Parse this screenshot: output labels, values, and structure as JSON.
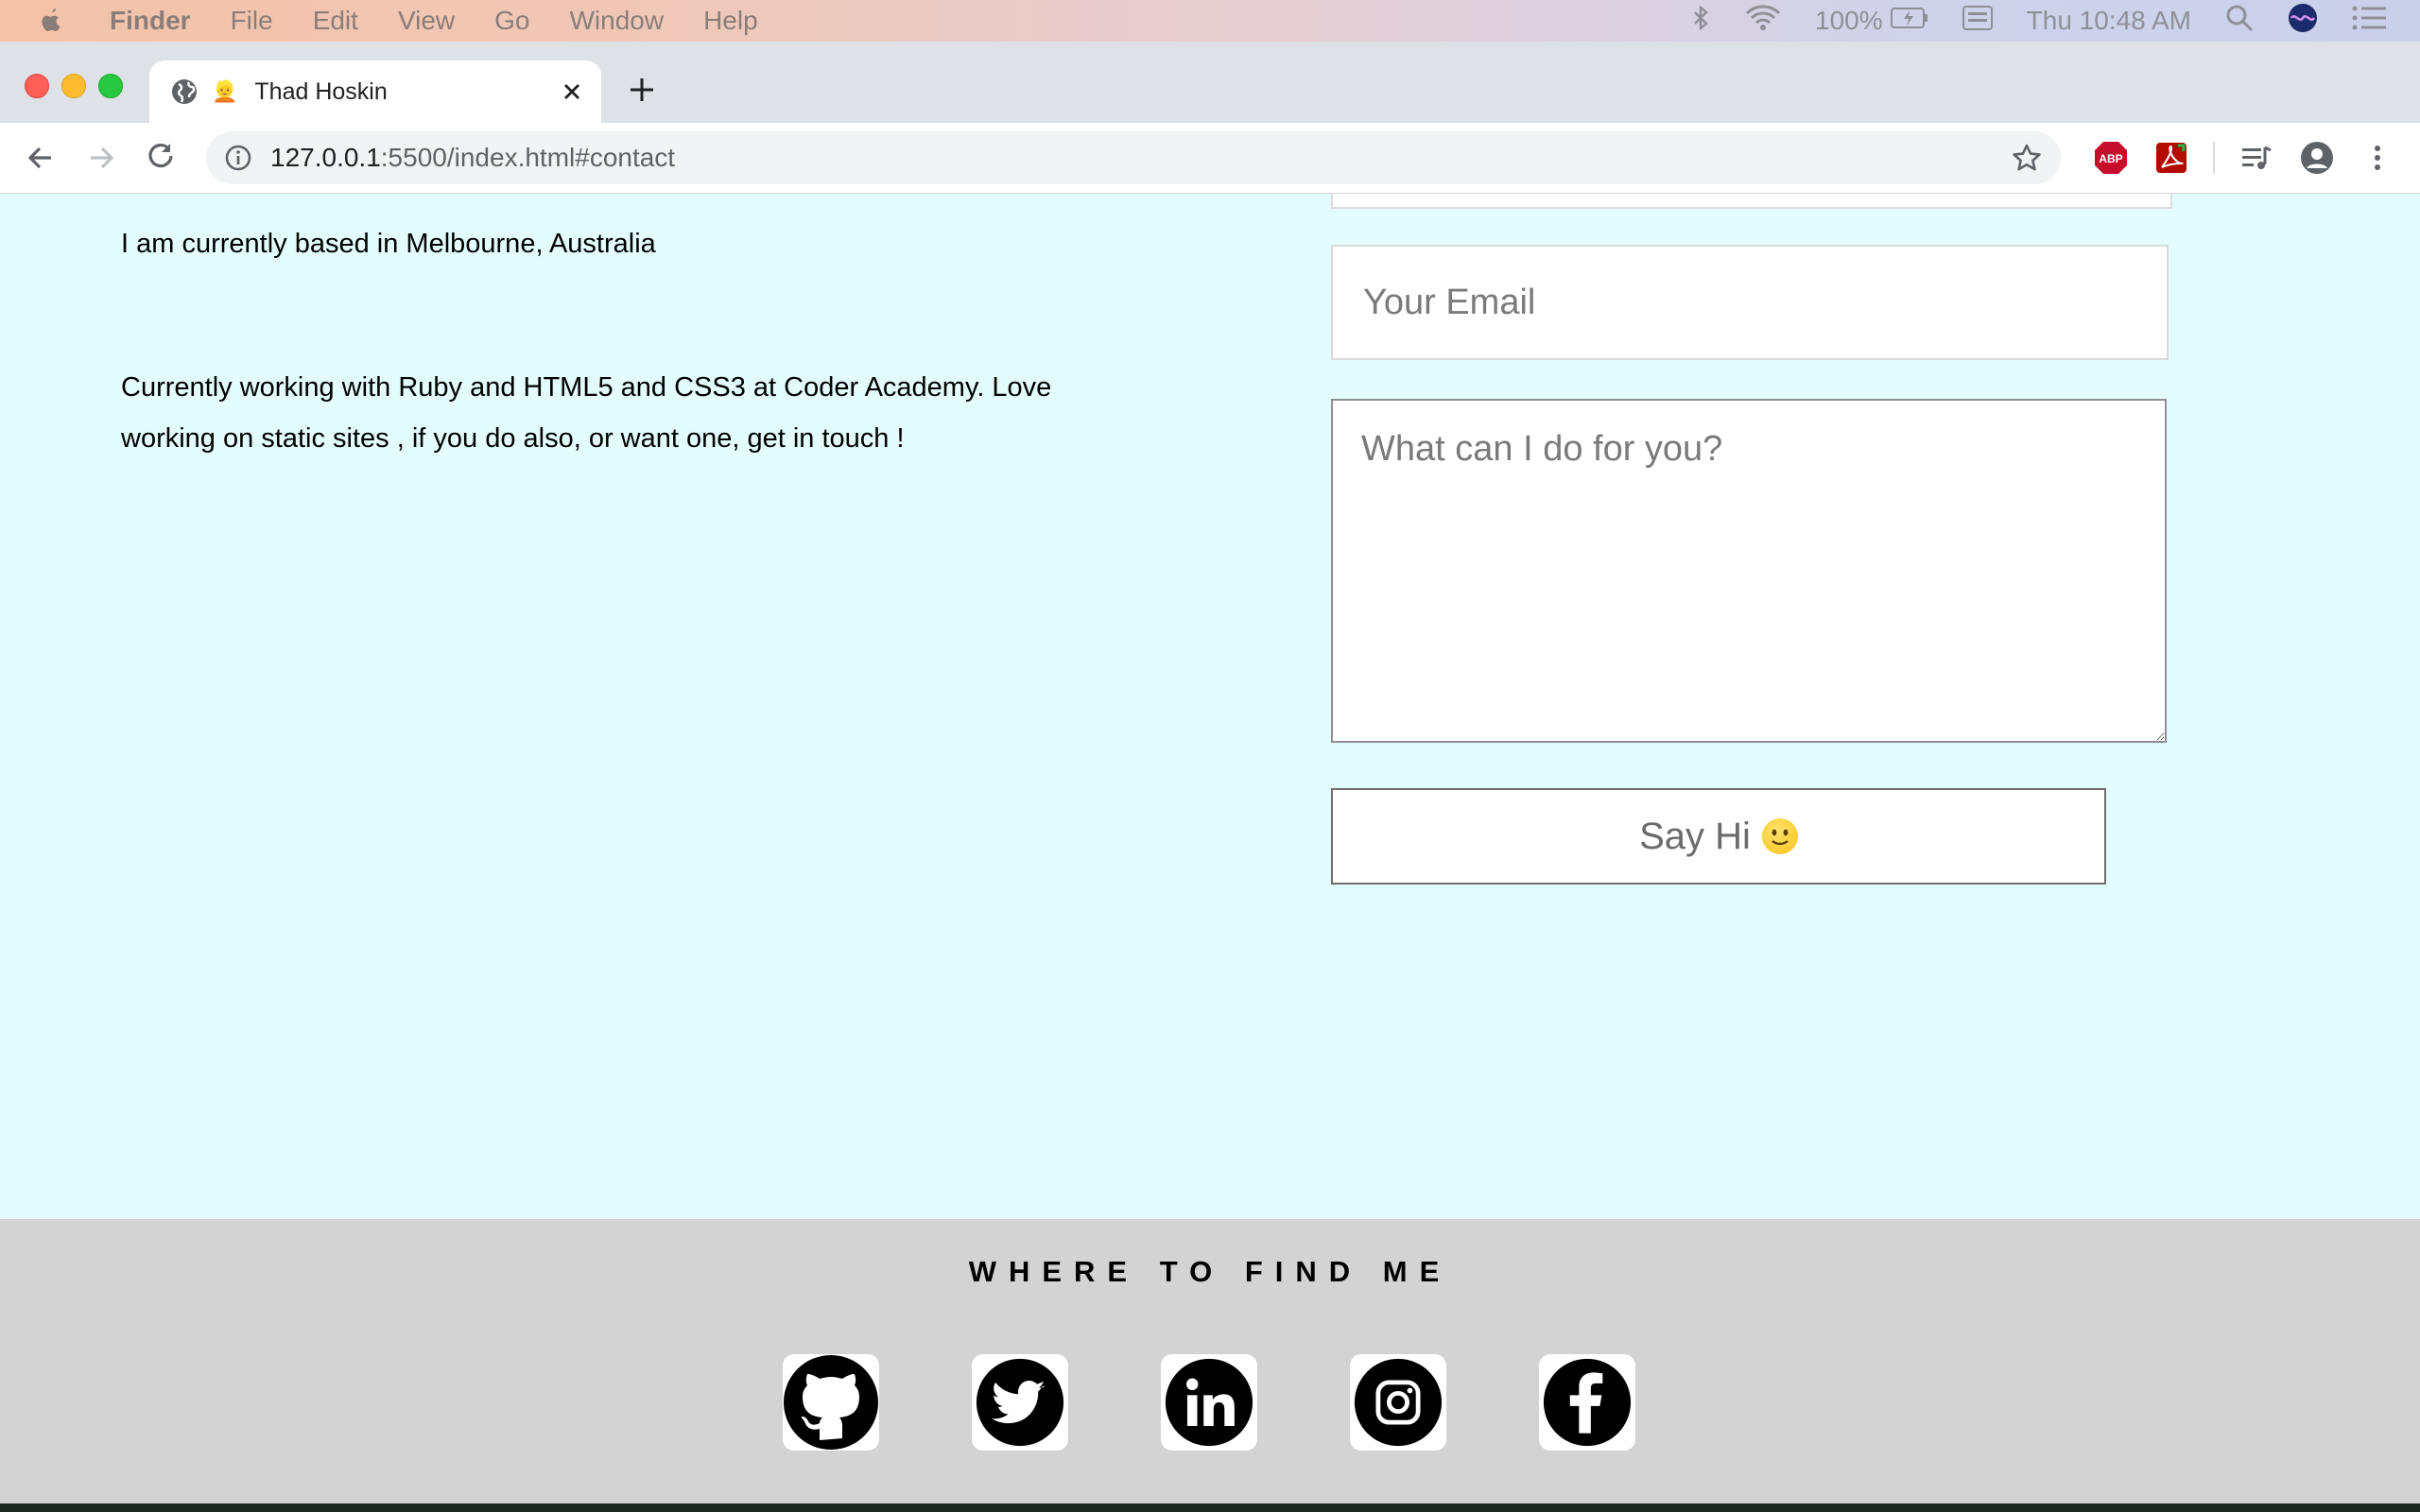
{
  "menubar": {
    "app_name": "Finder",
    "items": [
      "File",
      "Edit",
      "View",
      "Go",
      "Window",
      "Help"
    ],
    "battery": "100%",
    "clock": "Thu 10:48 AM"
  },
  "browser": {
    "tab_title": "Thad Hoskin",
    "tab_favicon": "👱",
    "url_host": "127.0.0.1",
    "url_rest": ":5500/index.html#contact",
    "extensions": [
      "ABP",
      "pdf-extension-icon",
      "media-control-icon",
      "profile-icon",
      "menu-icon"
    ]
  },
  "about": {
    "location": "I am currently based in Melbourne, Australia",
    "bio": "Currently working with Ruby and HTML5 and CSS3 at Coder Academy. Love working on static sites , if you do also, or want one, get in touch !"
  },
  "contact_form": {
    "email_placeholder": "Your Email",
    "message_placeholder": "What can I do for you?",
    "submit_label": "Say Hi"
  },
  "footer": {
    "title": "WHERE TO FIND ME",
    "socials": [
      "github",
      "twitter",
      "linkedin",
      "instagram",
      "facebook"
    ]
  },
  "colors": {
    "page_bg": "#e3fdfd",
    "footer_bg": "#d3d3d3",
    "tabstrip_bg": "#dee1e6"
  }
}
